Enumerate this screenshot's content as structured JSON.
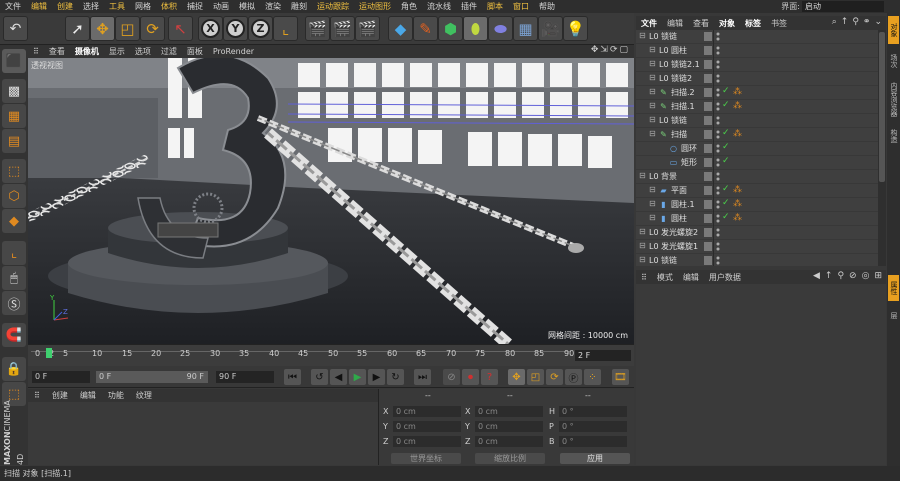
{
  "menubar": {
    "items": [
      "文件",
      "编辑",
      "创建",
      "选择",
      "工具",
      "网格",
      "体积",
      "捕捉",
      "动画",
      "模拟",
      "渲染",
      "雕刻",
      "运动跟踪",
      "运动图形",
      "角色",
      "流水线",
      "插件",
      "脚本",
      "窗口",
      "帮助"
    ],
    "highlighted": [
      "编辑",
      "创建",
      "工具",
      "体积",
      "运动跟踪",
      "运动图形",
      "脚本",
      "窗口"
    ],
    "layout_label": "界面:",
    "layout_value": "启动"
  },
  "toolbar": {
    "axis_x": "X",
    "axis_y": "Y",
    "axis_z": "Z"
  },
  "viewport": {
    "menu": [
      "查看",
      "摄像机",
      "显示",
      "选项",
      "过滤",
      "面板",
      "ProRender"
    ],
    "active_menu": "摄像机",
    "view_label": "透视视图",
    "grid_label": "网格间距 : 10000 cm",
    "axis_y": "Y",
    "axis_z": "Z"
  },
  "timeline": {
    "ticks": [
      "0",
      "2",
      "5",
      "10",
      "15",
      "20",
      "25",
      "30",
      "35",
      "40",
      "45",
      "50",
      "55",
      "60",
      "65",
      "70",
      "75",
      "80",
      "85",
      "90"
    ],
    "current_frame": "2 F"
  },
  "transport": {
    "start_frame": "0 F",
    "min_frame": "0 F",
    "slider_end": "90 F",
    "end_frame": "90 F"
  },
  "material_manager": {
    "menu": [
      "创建",
      "编辑",
      "功能",
      "纹理"
    ]
  },
  "coordinates": {
    "headers": [
      "--",
      "--",
      "--"
    ],
    "rows": [
      {
        "l1": "X",
        "v1": "0 cm",
        "l2": "X",
        "v2": "0 cm",
        "l3": "H",
        "v3": "0 °"
      },
      {
        "l1": "Y",
        "v1": "0 cm",
        "l2": "Y",
        "v2": "0 cm",
        "l3": "P",
        "v3": "0 °"
      },
      {
        "l1": "Z",
        "v1": "0 cm",
        "l2": "Z",
        "v2": "0 cm",
        "l3": "B",
        "v3": "0 °"
      }
    ],
    "world_dropdown": "世界坐标",
    "scale_dropdown": "缩放比例",
    "apply_label": "应用"
  },
  "object_manager": {
    "menu": [
      "文件",
      "编辑",
      "查看",
      "对象",
      "标签",
      "书签"
    ],
    "active_menu": [
      "文件",
      "对象",
      "标签"
    ],
    "rows": [
      {
        "name": "锁链",
        "indent": 0,
        "icon": "null-icon",
        "check": false,
        "tag": false
      },
      {
        "name": "圆柱",
        "indent": 1,
        "icon": "null-icon",
        "check": false,
        "tag": false
      },
      {
        "name": "锁链2.1",
        "indent": 1,
        "icon": "null-icon",
        "check": false,
        "tag": false
      },
      {
        "name": "锁链2",
        "indent": 1,
        "icon": "null-icon",
        "check": false,
        "tag": false
      },
      {
        "name": "扫描.2",
        "indent": 1,
        "icon": "sweep-icon",
        "check": true,
        "tag": true
      },
      {
        "name": "扫描.1",
        "indent": 1,
        "icon": "sweep-icon",
        "check": true,
        "tag": true
      },
      {
        "name": "锁链",
        "indent": 1,
        "icon": "null-icon",
        "check": false,
        "tag": false
      },
      {
        "name": "扫描",
        "indent": 1,
        "icon": "sweep-icon",
        "check": true,
        "tag": true
      },
      {
        "name": "圆环",
        "indent": 2,
        "icon": "circle-spline-icon",
        "check": true,
        "tag": false
      },
      {
        "name": "矩形",
        "indent": 2,
        "icon": "rectangle-spline-icon",
        "check": true,
        "tag": false
      },
      {
        "name": "背景",
        "indent": 0,
        "icon": "null-icon",
        "check": false,
        "tag": false
      },
      {
        "name": "平面",
        "indent": 1,
        "icon": "plane-icon",
        "check": true,
        "tag": true
      },
      {
        "name": "圆柱.1",
        "indent": 1,
        "icon": "cylinder-icon",
        "check": true,
        "tag": true
      },
      {
        "name": "圆柱",
        "indent": 1,
        "icon": "cylinder-icon",
        "check": true,
        "tag": true
      },
      {
        "name": "发光螺旋2",
        "indent": 0,
        "icon": "null-icon",
        "check": false,
        "tag": false
      },
      {
        "name": "发光螺旋1",
        "indent": 0,
        "icon": "null-icon",
        "check": false,
        "tag": false
      },
      {
        "name": "锁链",
        "indent": 0,
        "icon": "null-icon",
        "check": false,
        "tag": false
      }
    ]
  },
  "attribute_manager": {
    "menu": [
      "模式",
      "编辑",
      "用户数据"
    ]
  },
  "right_tabs": [
    "对象",
    "场次",
    "内容浏览器",
    "构造",
    "属性",
    "层"
  ],
  "status": "扫描 对象 [扫描.1]",
  "brand": {
    "line1": "MAXON",
    "line2": "CINEMA 4D"
  }
}
